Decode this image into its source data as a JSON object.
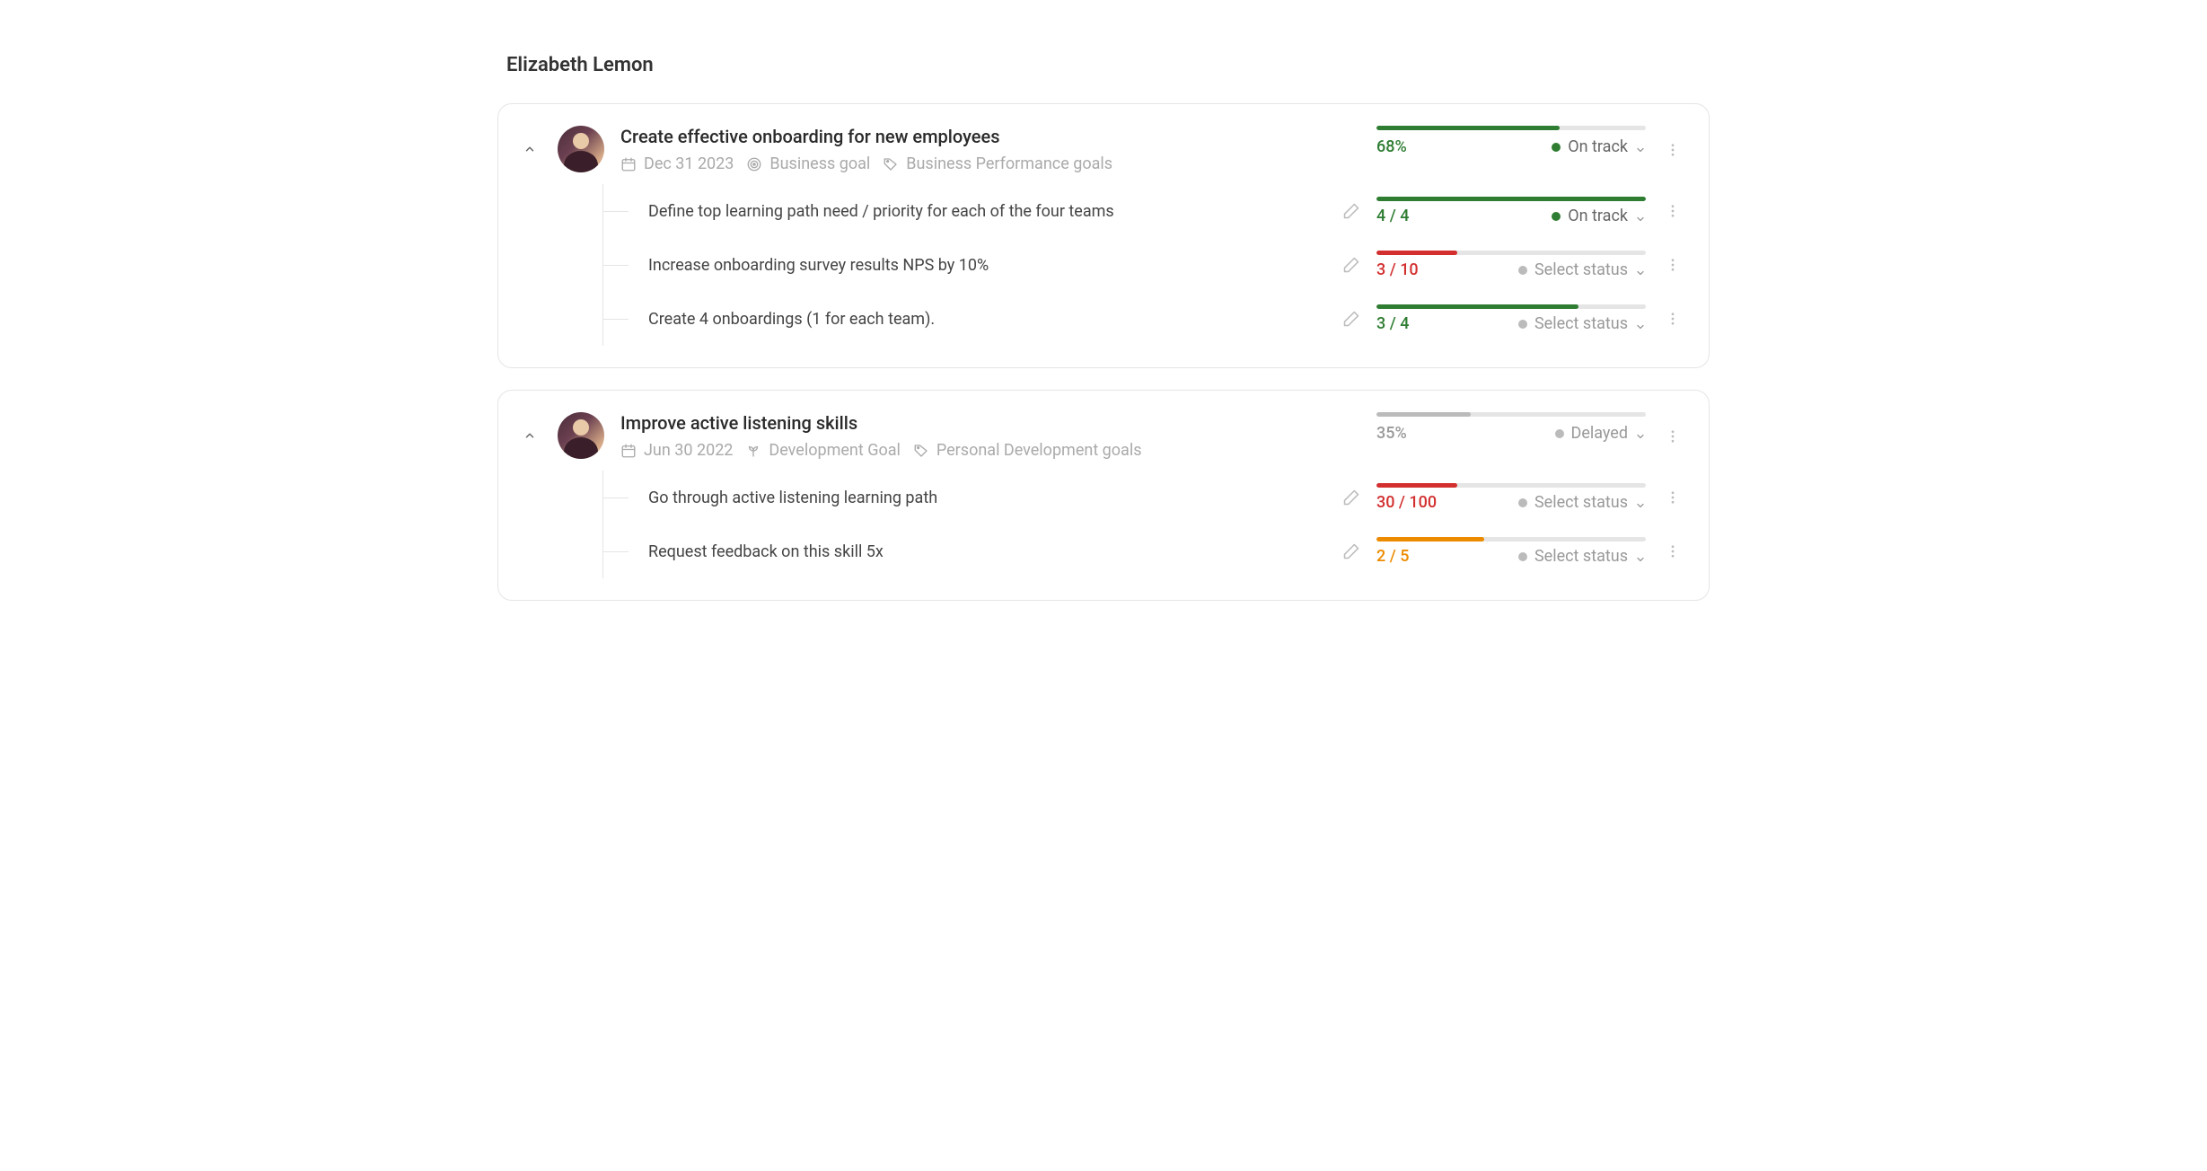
{
  "page_title": "Elizabeth Lemon",
  "goals": [
    {
      "title": "Create effective onboarding for new employees",
      "date": "Dec 31 2023",
      "category": "Business goal",
      "tag": "Business Performance goals",
      "progress_text": "68%",
      "progress_pct": 68,
      "progress_color": "green",
      "status_label": "On track",
      "status_color": "green",
      "children": [
        {
          "title": "Define top learning path need / priority for each of the four teams",
          "progress_text": "4 / 4",
          "progress_pct": 100,
          "progress_color": "green",
          "status_label": "On track",
          "status_color": "green"
        },
        {
          "title": "Increase onboarding survey results NPS by 10%",
          "progress_text": "3 / 10",
          "progress_pct": 30,
          "progress_color": "red",
          "status_label": "Select status",
          "status_color": "gray"
        },
        {
          "title": "Create 4 onboardings (1 for each team).",
          "progress_text": "3 / 4",
          "progress_pct": 75,
          "progress_color": "green",
          "status_label": "Select status",
          "status_color": "gray"
        }
      ]
    },
    {
      "title": "Improve active listening skills",
      "date": "Jun 30 2022",
      "category": "Development Goal",
      "tag": "Personal Development goals",
      "progress_text": "35%",
      "progress_pct": 35,
      "progress_color": "gray",
      "status_label": "Delayed",
      "status_color": "gray",
      "children": [
        {
          "title": "Go through active listening learning path",
          "progress_text": "30 / 100",
          "progress_pct": 30,
          "progress_color": "red",
          "status_label": "Select status",
          "status_color": "gray"
        },
        {
          "title": "Request feedback on this skill 5x",
          "progress_text": "2 / 5",
          "progress_pct": 40,
          "progress_color": "orange",
          "status_label": "Select status",
          "status_color": "gray"
        }
      ]
    }
  ],
  "icons": {
    "calendar": "calendar-icon",
    "target": "target-icon",
    "tag": "tag-icon",
    "plant": "plant-icon",
    "pencil": "pencil-icon",
    "dots": "dots-icon"
  }
}
